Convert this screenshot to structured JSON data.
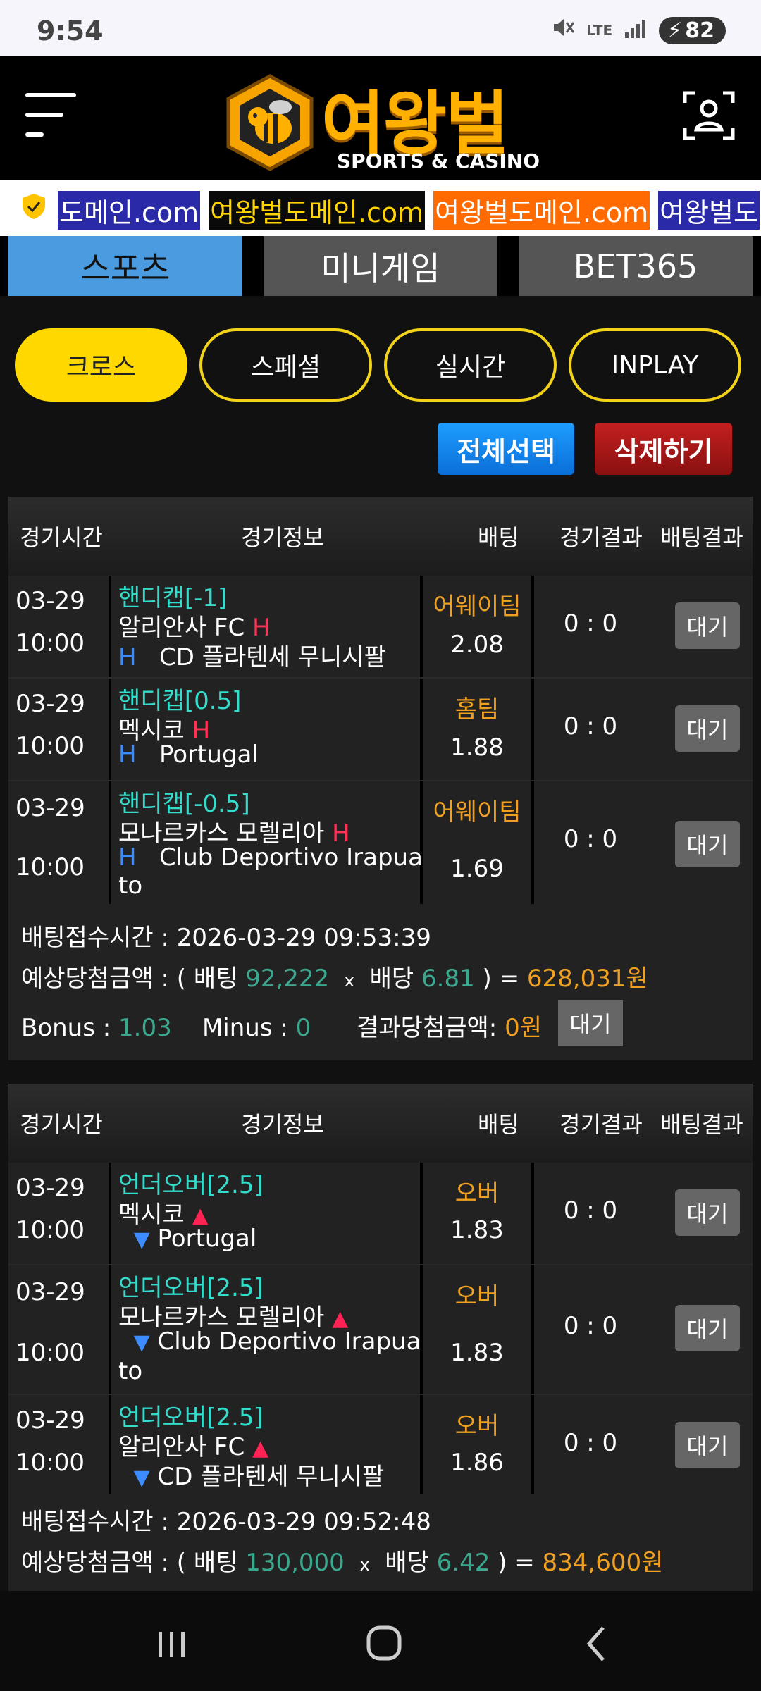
{
  "status_bar": {
    "time": "9:54",
    "network": "LTE",
    "battery": "82"
  },
  "header": {
    "logo_title": "여왕벌",
    "logo_sub": "SPORTS & CASINO"
  },
  "marquee": [
    "도메인.com",
    "여왕벌도메인.com",
    "여왕벌도메인.com",
    "여왕벌도"
  ],
  "tabs": [
    {
      "label": "스포츠",
      "active": true
    },
    {
      "label": "미니게임",
      "active": false
    },
    {
      "label": "BET365",
      "active": false
    }
  ],
  "filters": [
    {
      "label": "크로스",
      "active": true
    },
    {
      "label": "스페셜",
      "active": false
    },
    {
      "label": "실시간",
      "active": false
    },
    {
      "label": "INPLAY",
      "active": false
    }
  ],
  "actions": {
    "select_all": "전체선택",
    "delete": "삭제하기"
  },
  "columns": {
    "time": "경기시간",
    "info": "경기정보",
    "bet": "배팅",
    "result": "경기결과",
    "bet_result": "배팅결과"
  },
  "bets": [
    {
      "rows": [
        {
          "date": "03-29",
          "time": "10:00",
          "market": "핸디캡[-1]",
          "home": "알리안사 FC",
          "away": "CD 플라텐세 무니시팔",
          "away_cont": "",
          "pick": "어웨이팀",
          "odds": "2.08",
          "score": "0 : 0",
          "status": "대기"
        },
        {
          "date": "03-29",
          "time": "10:00",
          "market": "핸디캡[0.5]",
          "home": "멕시코",
          "away": "Portugal",
          "away_cont": "",
          "pick": "홈팀",
          "odds": "1.88",
          "score": "0 : 0",
          "status": "대기"
        },
        {
          "date": "03-29",
          "time": "10:00",
          "market": "핸디캡[-0.5]",
          "home": "모나르카스 모렐리아",
          "away": "Club Deportivo Irapua",
          "away_cont": "to",
          "pick": "어웨이팀",
          "odds": "1.69",
          "score": "0 : 0",
          "status": "대기"
        }
      ],
      "summary": {
        "accepted_label": "배팅접수시간 : ",
        "accepted_time": "2026-03-29 09:53:39",
        "expected_label": "예상당첨금액 : ( 배팅 ",
        "stake": "92,222",
        "times": "x",
        "odds_label": "배당",
        "total_odds": "6.81",
        "equals": ") =",
        "payout": "628,031원",
        "bonus_label": "Bonus : ",
        "bonus": "1.03",
        "minus_label": "Minus : ",
        "minus": "0",
        "result_label": "결과당첨금액: ",
        "result_amount": "0원",
        "status": "대기"
      }
    },
    {
      "rows": [
        {
          "date": "03-29",
          "time": "10:00",
          "market": "언더오버[2.5]",
          "home": "멕시코",
          "away": "Portugal",
          "away_cont": "",
          "pick": "오버",
          "odds": "1.83",
          "score": "0 : 0",
          "status": "대기"
        },
        {
          "date": "03-29",
          "time": "10:00",
          "market": "언더오버[2.5]",
          "home": "모나르카스 모렐리아",
          "away": "Club Deportivo Irapua",
          "away_cont": "to",
          "pick": "오버",
          "odds": "1.83",
          "score": "0 : 0",
          "status": "대기"
        },
        {
          "date": "03-29",
          "time": "10:00",
          "market": "언더오버[2.5]",
          "home": "알리안사 FC",
          "away": "CD 플라텐세 무니시팔",
          "away_cont": "",
          "pick": "오버",
          "odds": "1.86",
          "score": "0 : 0",
          "status": "대기"
        }
      ],
      "summary": {
        "accepted_label": "배팅접수시간 : ",
        "accepted_time": "2026-03-29 09:52:48",
        "expected_label": "예상당첨금액 : ( 배팅 ",
        "stake": "130,000",
        "times": "x",
        "odds_label": "배당",
        "total_odds": "6.42",
        "equals": ") =",
        "payout": "834,600원"
      }
    }
  ],
  "handicap_marker": "H",
  "colors": {
    "accent_yellow": "#ffd800",
    "tab_blue": "#4a9be0",
    "odds_amber": "#f0a020",
    "market_teal": "#33ddcc"
  }
}
